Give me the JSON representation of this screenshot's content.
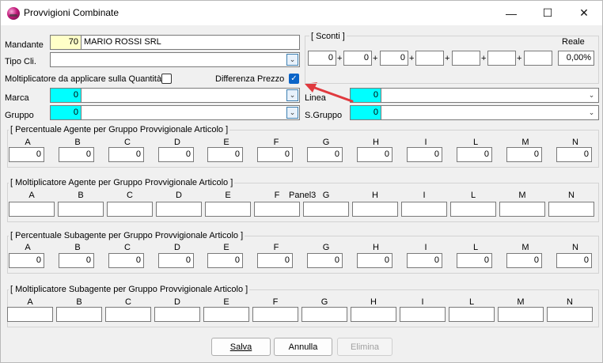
{
  "window": {
    "title": "Provvigioni Combinate",
    "minimize": "—",
    "maximize": "☐",
    "close": "✕"
  },
  "form": {
    "mandante_label": "Mandante",
    "mandante_code": "70",
    "mandante_name": "MARIO ROSSI SRL",
    "tipo_cli_label": "Tipo Cli.",
    "moltiplicatore_label": "Moltiplicatore da applicare sulla Quantità",
    "differenza_prezzo_label": "Differenza Prezzo",
    "marca_label": "Marca",
    "marca_value": "0",
    "gruppo_label": "Gruppo",
    "gruppo_value": "0",
    "linea_label": "Linea",
    "linea_value": "0",
    "sgruppo_label": "S.Gruppo",
    "sgruppo_value": "0"
  },
  "sconti": {
    "title": "[ Sconti ]",
    "reale_label": "Reale",
    "values": [
      "0",
      "0",
      "0",
      "",
      "",
      "",
      ""
    ],
    "plus": "+",
    "reale_value": "0,00%"
  },
  "columns": [
    "A",
    "B",
    "C",
    "D",
    "E",
    "F",
    "G",
    "H",
    "I",
    "L",
    "M",
    "N"
  ],
  "groups": {
    "perc_agente": {
      "title": "[ Percentuale Agente per Gruppo Provvigionale Articolo ]",
      "values": [
        "0",
        "0",
        "0",
        "0",
        "0",
        "0",
        "0",
        "0",
        "0",
        "0",
        "0",
        "0"
      ]
    },
    "molt_agente": {
      "title": "[ Moltiplicatore Agente per Gruppo Provvigionale Articolo ]",
      "panel_label": "Panel3"
    },
    "perc_subagente": {
      "title": "[ Percentuale Subagente per Gruppo Provvigionale Articolo ]",
      "values": [
        "0",
        "0",
        "0",
        "0",
        "0",
        "0",
        "0",
        "0",
        "0",
        "0",
        "0",
        "0"
      ]
    },
    "molt_subagente": {
      "title": "[ Moltiplicatore Subagente per Gruppo Provvigionale Articolo ]"
    }
  },
  "buttons": {
    "salva": "Salva",
    "annulla": "Annulla",
    "elimina": "Elimina"
  },
  "colors": {
    "highlight_yellow": "#ffffc8",
    "highlight_cyan": "#00ffff",
    "arrow_red": "#e0393e",
    "check_blue": "#0a64c8"
  }
}
